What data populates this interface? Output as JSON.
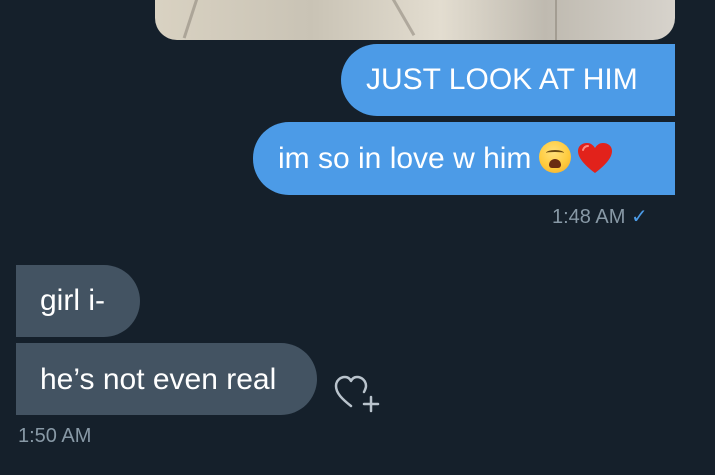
{
  "messages": {
    "sent": [
      {
        "text": "JUST LOOK AT HIM"
      },
      {
        "text": "im so in love w him",
        "emojis": [
          "weary-face-emoji",
          "red-heart-emoji"
        ]
      }
    ],
    "sent_time": "1:48 AM",
    "sent_status": "✓",
    "received": [
      {
        "text": "girl i-"
      },
      {
        "text": "he’s not even real"
      }
    ],
    "received_time": "1:50 AM"
  },
  "icons": {
    "react": "heart-plus-icon",
    "read": "checkmark-icon"
  },
  "colors": {
    "background": "#15202b",
    "sent_bubble": "#4c9be7",
    "received_bubble": "#435362",
    "meta_text": "#8899a6"
  }
}
